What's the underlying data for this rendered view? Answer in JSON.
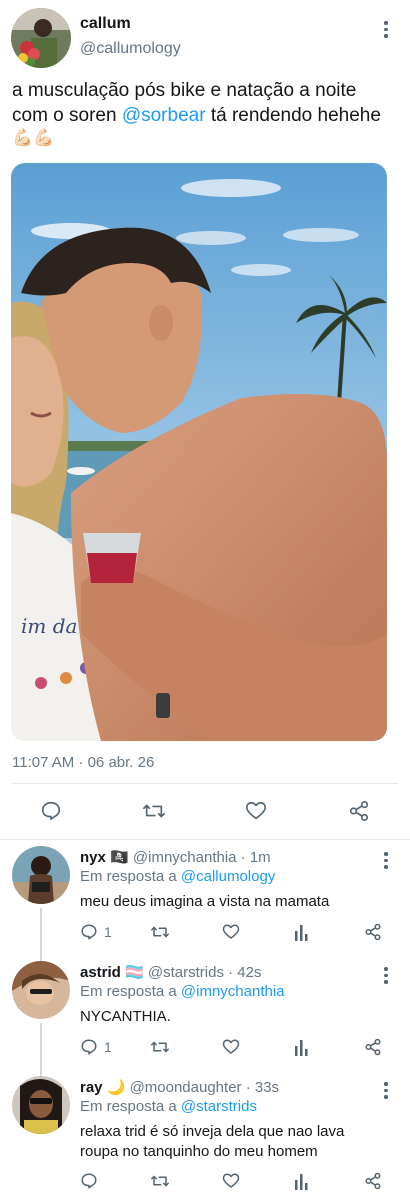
{
  "tweet": {
    "author_name": "callum",
    "author_handle": "@callumology",
    "text_line1": "a musculação pós bike e natação a noite",
    "text_line2_before": "com o soren ",
    "text_line2_mention": "@sorbear",
    "text_line2_after": " tá rendendo hehehe",
    "emojis": "💪🏻💪🏻",
    "timestamp": "11:07 AM · 06 abr. 26"
  },
  "actions": {
    "reply_icon": "reply-icon",
    "retweet_icon": "retweet-icon",
    "like_icon": "heart-icon",
    "share_icon": "share-icon"
  },
  "replies": [
    {
      "name": "nyx",
      "flag": "🏴‍☠️",
      "handle": "@imnychanthia",
      "time": "· 1m",
      "replying_label": "Em resposta a ",
      "replying_to": "@callumology",
      "text_lines": [
        "meu deus imagina a vista na mamata"
      ],
      "reply_count": "1"
    },
    {
      "name": "astrid",
      "flag": "🏳️‍⚧️",
      "handle": "@starstrids",
      "time": "· 42s",
      "replying_label": "Em resposta a ",
      "replying_to": "@imnychanthia",
      "text_lines": [
        "NYCANTHIA."
      ],
      "reply_count": "1"
    },
    {
      "name": "ray",
      "flag": "🌙",
      "handle": "@moondaughter",
      "time": "· 33s",
      "replying_label": "Em resposta a ",
      "replying_to": "@starstrids",
      "text_lines": [
        "relaxa trid é só inveja dela que nao lava",
        "roupa no tanquinho do meu homem"
      ],
      "reply_count": ""
    }
  ],
  "colors": {
    "accent": "#1d9bf0",
    "secondary_text": "#657786",
    "primary_text": "#14171a",
    "divider": "#e1e8ed"
  }
}
